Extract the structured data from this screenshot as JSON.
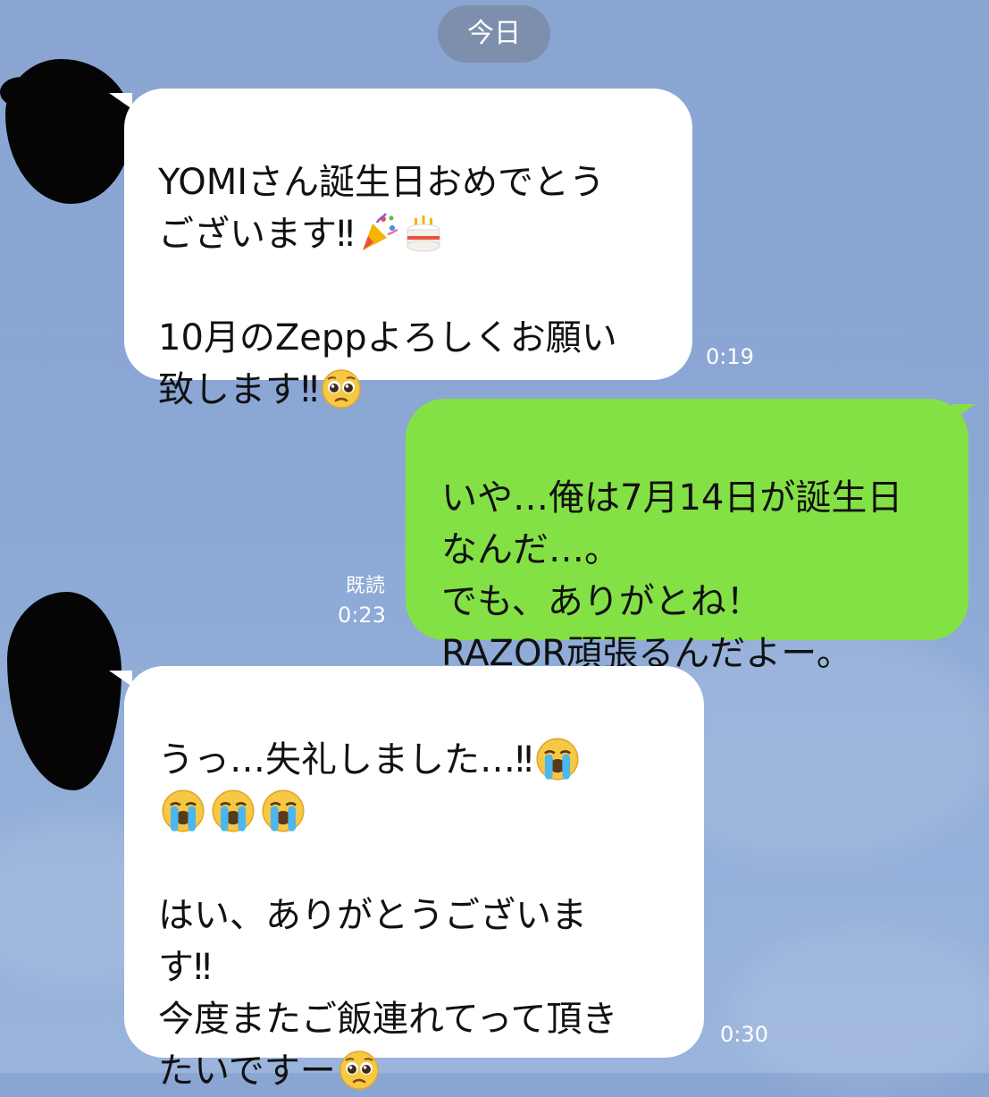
{
  "header": {
    "date_label": "今日"
  },
  "messages": [
    {
      "direction": "incoming",
      "time": "0:19",
      "segments": [
        {
          "text": "YOMIさん誕生日おめでとう"
        },
        {
          "text": "\nございます‼"
        },
        {
          "emoji": "party-popper-icon"
        },
        {
          "emoji": "birthday-cake-icon"
        },
        {
          "text": "\n\n10月のZeppよろしくお願い"
        },
        {
          "text": "\n致します‼"
        },
        {
          "emoji": "pleading-face-icon"
        }
      ]
    },
    {
      "direction": "outgoing",
      "read_label": "既読",
      "time": "0:23",
      "segments": [
        {
          "text": "いや…俺は7月14日が誕生日"
        },
        {
          "text": "\nなんだ…。"
        },
        {
          "text": "\nでも、ありがとね！"
        },
        {
          "text": "\nRAZOR頑張るんだよー。"
        }
      ]
    },
    {
      "direction": "incoming",
      "time": "0:30",
      "segments": [
        {
          "text": "うっ…失礼しました…‼"
        },
        {
          "emoji": "loudly-crying-face-icon"
        },
        {
          "text": "\n"
        },
        {
          "emoji": "loudly-crying-face-icon"
        },
        {
          "emoji": "loudly-crying-face-icon"
        },
        {
          "emoji": "loudly-crying-face-icon"
        },
        {
          "text": "\n\nはい、ありがとうございま"
        },
        {
          "text": "\nす‼"
        },
        {
          "text": "\n今度またご飯連れてって頂き"
        },
        {
          "text": "\nたいですー"
        },
        {
          "emoji": "pleading-face-icon"
        }
      ]
    }
  ],
  "colors": {
    "background": "#8ba7d4",
    "incoming_bubble": "#ffffff",
    "outgoing_bubble": "#84e145",
    "date_pill": "#7d8fad"
  }
}
